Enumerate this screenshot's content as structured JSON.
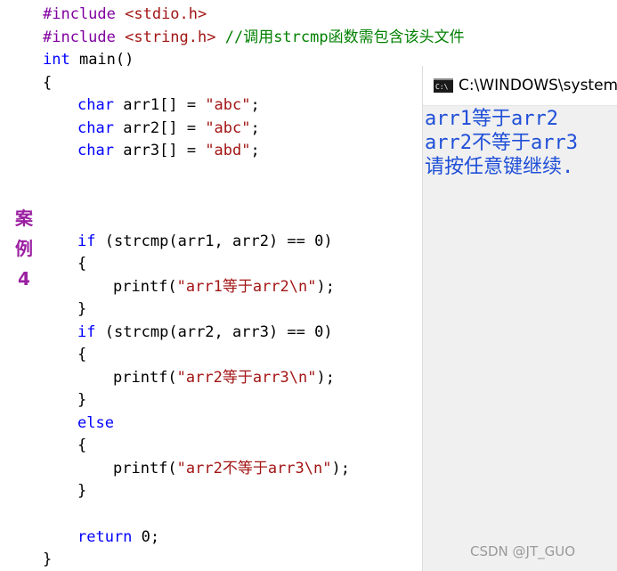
{
  "code": {
    "line_include1_directive": "#include",
    "line_include1_path": " <stdio.h>",
    "line_include2_directive": "#include",
    "line_include2_path": " <string.h>",
    "line_include2_comment": " //调用strcmp函数需包含该头文件",
    "line_main_kw": "int",
    "line_main_rest": " main()",
    "brace_open": "{",
    "arr1_kw": "char",
    "arr1_rest": " arr1[] = ",
    "arr1_str": "\"abc\"",
    "arr1_end": ";",
    "arr2_kw": "char",
    "arr2_rest": " arr2[] = ",
    "arr2_str": "\"abc\"",
    "arr2_end": ";",
    "arr3_kw": "char",
    "arr3_rest": " arr3[] = ",
    "arr3_str": "\"abd\"",
    "arr3_end": ";",
    "if1_kw": "if",
    "if1_rest": " (strcmp(arr1, arr2) == 0)",
    "if1_open": "{",
    "printf1_fn": "printf(",
    "printf1_str": "\"arr1等于arr2\\n\"",
    "printf1_end": ");",
    "if1_close": "}",
    "if2_kw": "if",
    "if2_rest": " (strcmp(arr2, arr3) == 0)",
    "if2_open": "{",
    "printf2_fn": "printf(",
    "printf2_str": "\"arr2等于arr3\\n\"",
    "printf2_end": ");",
    "if2_close": "}",
    "else_kw": "else",
    "else_open": "{",
    "printf3_fn": "printf(",
    "printf3_str": "\"arr2不等于arr3\\n\"",
    "printf3_end": ");",
    "else_close": "}",
    "return_kw": "return",
    "return_rest": " 0;",
    "brace_close": "}"
  },
  "case_label": [
    "案",
    "例",
    "4"
  ],
  "console": {
    "title": "C:\\WINDOWS\\system",
    "icon": "cmd-icon",
    "output": [
      "arr1等于arr2",
      "arr2不等于arr3",
      "请按任意键继续."
    ]
  },
  "watermark": "CSDN @JT_GUO",
  "colors": {
    "keyword": "#0000ff",
    "string": "#a31515",
    "comment": "#008000",
    "preprocessor": "#8000a0",
    "console_text": "#1f4fd8",
    "case_label": "#9b1fa2"
  }
}
